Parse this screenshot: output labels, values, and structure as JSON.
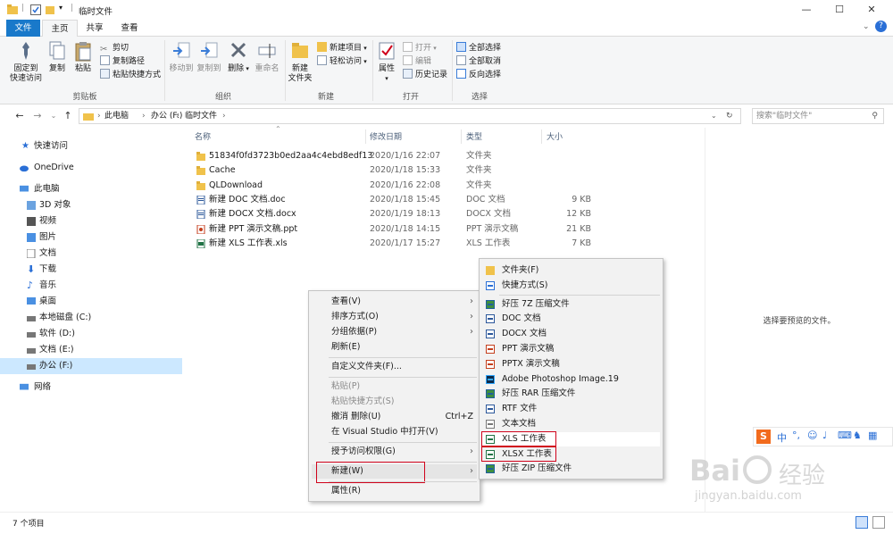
{
  "window": {
    "title": "临时文件",
    "controls": {
      "minimize": "—",
      "maximize": "☐",
      "close": "✕"
    }
  },
  "tabs": [
    "文件",
    "主页",
    "共享",
    "查看"
  ],
  "ribbon": {
    "clipboard": {
      "label": "剪贴板",
      "pin": "固定到\n快速访问",
      "pin_1": "固定到",
      "pin_2": "快速访问",
      "copy": "复制",
      "paste": "粘贴",
      "cut": "剪切",
      "copy_path": "复制路径",
      "paste_shortcut": "粘贴快捷方式"
    },
    "organize": {
      "label": "组织",
      "move_to": "移动到",
      "copy_to": "复制到",
      "delete": "删除",
      "rename": "重命名"
    },
    "new": {
      "label": "新建",
      "new_folder_1": "新建",
      "new_folder_2": "文件夹",
      "new_item": "新建项目",
      "easy_access": "轻松访问"
    },
    "open": {
      "label": "打开",
      "properties": "属性",
      "open": "打开",
      "edit": "编辑",
      "history": "历史记录"
    },
    "select": {
      "label": "选择",
      "select_all": "全部选择",
      "select_none": "全部取消",
      "invert": "反向选择"
    }
  },
  "address": {
    "path": [
      "此电脑",
      "办公 (F:)",
      "临时文件"
    ],
    "search_placeholder": "搜索\"临时文件\""
  },
  "nav": {
    "quick_access": "快速访问",
    "onedrive": "OneDrive",
    "this_pc": "此电脑",
    "items": [
      "3D 对象",
      "视频",
      "图片",
      "文档",
      "下载",
      "音乐",
      "桌面",
      "本地磁盘 (C:)",
      "软件 (D:)",
      "文档 (E:)",
      "办公 (F:)"
    ],
    "network": "网络"
  },
  "columns": {
    "name": "名称",
    "modified": "修改日期",
    "type": "类型",
    "size": "大小"
  },
  "files": [
    {
      "name": "51834f0fd3723b0ed2aa4c4ebd8edf13",
      "modified": "2020/1/16 22:07",
      "type": "文件夹",
      "size": "",
      "icon": "folder"
    },
    {
      "name": "Cache",
      "modified": "2020/1/18 15:33",
      "type": "文件夹",
      "size": "",
      "icon": "folder"
    },
    {
      "name": "QLDownload",
      "modified": "2020/1/16 22:08",
      "type": "文件夹",
      "size": "",
      "icon": "folder"
    },
    {
      "name": "新建 DOC 文档.doc",
      "modified": "2020/1/18 15:45",
      "type": "DOC 文档",
      "size": "9 KB",
      "icon": "doc"
    },
    {
      "name": "新建 DOCX 文档.docx",
      "modified": "2020/1/19 18:13",
      "type": "DOCX 文档",
      "size": "12 KB",
      "icon": "doc"
    },
    {
      "name": "新建 PPT 演示文稿.ppt",
      "modified": "2020/1/18 14:15",
      "type": "PPT 演示文稿",
      "size": "21 KB",
      "icon": "ppt"
    },
    {
      "name": "新建 XLS 工作表.xls",
      "modified": "2020/1/17 15:27",
      "type": "XLS 工作表",
      "size": "7 KB",
      "icon": "xls"
    }
  ],
  "preview_message": "选择要预览的文件。",
  "status": {
    "count": "7 个项目"
  },
  "context_menu": {
    "view": "查看(V)",
    "sort": "排序方式(O)",
    "group": "分组依据(P)",
    "refresh": "刷新(E)",
    "customize": "自定义文件夹(F)...",
    "paste": "粘贴(P)",
    "paste_shortcut": "粘贴快捷方式(S)",
    "undo": "撤消 删除(U)",
    "undo_shortcut": "Ctrl+Z",
    "vs": "在 Visual Studio 中打开(V)",
    "access": "授予访问权限(G)",
    "new": "新建(W)",
    "properties": "属性(R)"
  },
  "new_submenu": [
    {
      "label": "文件夹(F)",
      "icon": "folder"
    },
    {
      "label": "快捷方式(S)",
      "icon": "shortcut"
    },
    {
      "label": "好压 7Z 压缩文件",
      "icon": "archive"
    },
    {
      "label": "DOC 文档",
      "icon": "doc"
    },
    {
      "label": "DOCX 文档",
      "icon": "doc"
    },
    {
      "label": "PPT 演示文稿",
      "icon": "ppt"
    },
    {
      "label": "PPTX 演示文稿",
      "icon": "ppt"
    },
    {
      "label": "Adobe Photoshop Image.19",
      "icon": "psd"
    },
    {
      "label": "好压 RAR 压缩文件",
      "icon": "archive"
    },
    {
      "label": "RTF 文件",
      "icon": "doc"
    },
    {
      "label": "文本文档",
      "icon": "txt"
    },
    {
      "label": "XLS 工作表",
      "icon": "xls"
    },
    {
      "label": "XLSX 工作表",
      "icon": "xls"
    },
    {
      "label": "好压 ZIP 压缩文件",
      "icon": "archive"
    }
  ],
  "ime_bar": {
    "logo": "S",
    "lang": "中"
  },
  "watermark": {
    "brand": "Bai",
    "brand_cn": "经验",
    "url": "jingyan.baidu.com"
  },
  "colors": {
    "accent": "#1979ca",
    "folder": "#f0c24b",
    "highlight": "#cce8ff",
    "redbox": "#d0021b"
  }
}
